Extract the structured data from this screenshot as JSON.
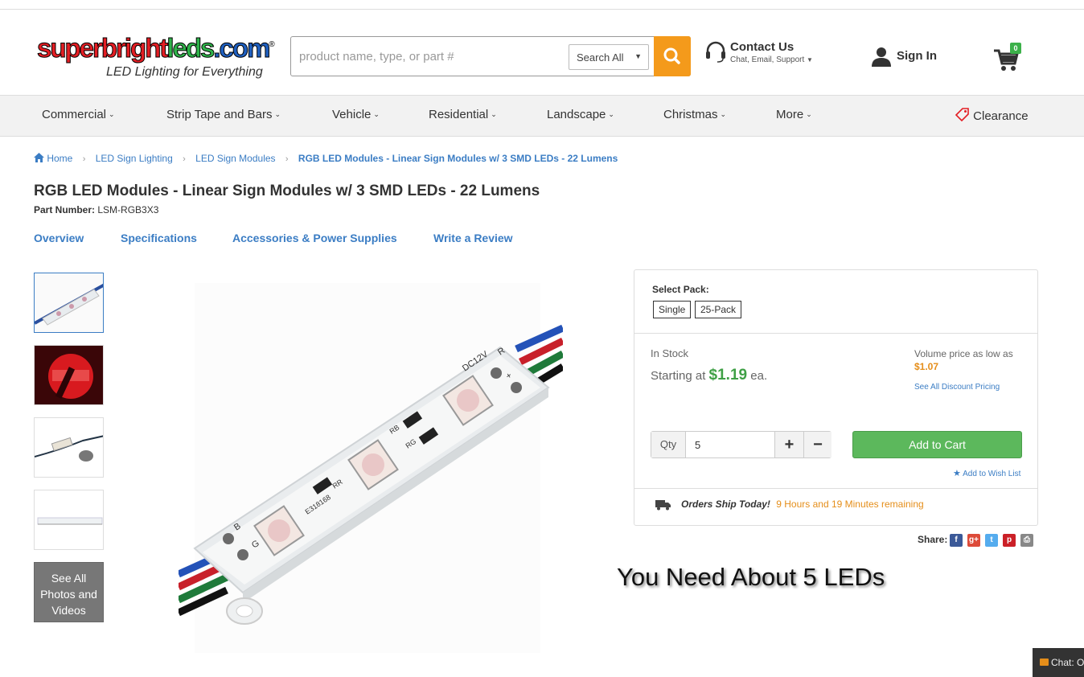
{
  "header": {
    "logo": {
      "part1": "superbright",
      "part2": "leds",
      "part3": ".com",
      "reg": "®",
      "tagline": "LED Lighting for Everything"
    },
    "search": {
      "placeholder": "product name, type, or part #",
      "scope": "Search All"
    },
    "contact": {
      "title": "Contact Us",
      "subtitle": "Chat, Email, Support"
    },
    "signin": "Sign In",
    "cart_count": "0"
  },
  "nav": {
    "items": [
      "Commercial",
      "Strip Tape and Bars",
      "Vehicle",
      "Residential",
      "Landscape",
      "Christmas",
      "More"
    ],
    "clearance": "Clearance"
  },
  "breadcrumb": {
    "items": [
      "Home",
      "LED Sign Lighting",
      "LED Sign Modules"
    ],
    "current": "RGB LED Modules - Linear Sign Modules w/ 3 SMD LEDs - 22 Lumens"
  },
  "product": {
    "title": "RGB LED Modules - Linear Sign Modules w/ 3 SMD LEDs - 22 Lumens",
    "part_label": "Part Number:",
    "part_number": "LSM-RGB3X3",
    "image_text": {
      "voltage": "DC12V",
      "pin_r": "R",
      "pin_plus": "+",
      "pin_b": "B",
      "pin_g": "G",
      "res1": "RB",
      "res2": "RG",
      "res3": "RR",
      "cert": "E318168"
    }
  },
  "tabs": [
    "Overview",
    "Specifications",
    "Accessories & Power Supplies",
    "Write a Review"
  ],
  "gallery": {
    "see_all": "See All Photos and Videos"
  },
  "purchase": {
    "select_pack_label": "Select Pack:",
    "packs": [
      "Single",
      "25-Pack"
    ],
    "stock": "In Stock",
    "starting_label": "Starting at",
    "price": "$1.19",
    "unit": "ea.",
    "volume_label": "Volume price as low as",
    "volume_price": "$1.07",
    "discount_link": "See All Discount Pricing",
    "qty_label": "Qty",
    "qty_value": "5",
    "plus": "+",
    "minus": "−",
    "add_to_cart": "Add to Cart",
    "wishlist": "Add to Wish List",
    "ship_title": "Orders Ship Today!",
    "ship_remaining": "9 Hours and 19 Minutes remaining"
  },
  "share": {
    "label": "Share:",
    "networks": [
      "f",
      "g+",
      "t",
      "p",
      "print"
    ]
  },
  "overlay_text": "You Need About 5 LEDs",
  "chat": "Chat: O",
  "colors": {
    "link": "#3b7dc4",
    "accent_orange": "#f49a1b",
    "price_green": "#3fa046",
    "cart_green": "#5cb85c"
  }
}
